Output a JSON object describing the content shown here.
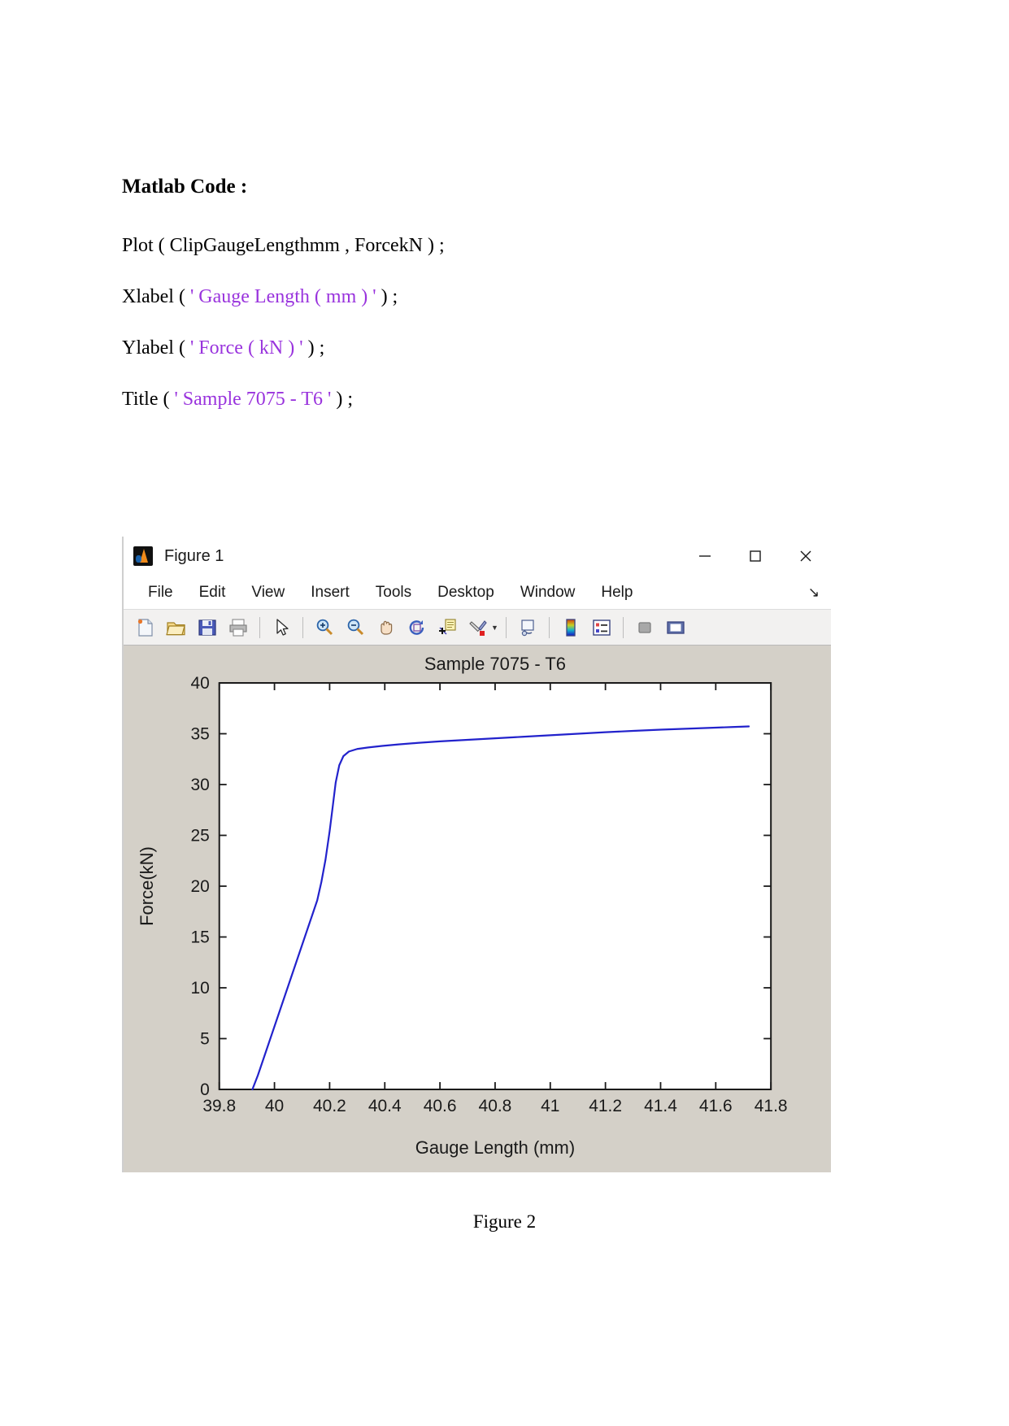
{
  "document": {
    "heading": "Matlab Code :",
    "code_lines": [
      {
        "pre": "Plot ( ClipGaugeLengthmm , ForcekN ) ;",
        "str": "",
        "post": ""
      },
      {
        "pre": "Xlabel ( ",
        "str": "' Gauge Length ( mm ) '",
        "post": " ) ;"
      },
      {
        "pre": "Ylabel ( ",
        "str": "' Force ( kN ) '",
        "post": " ) ;"
      },
      {
        "pre": "Title ( ",
        "str": "' Sample 7075 - T6 '",
        "post": " ) ;"
      }
    ],
    "caption": "Figure 2",
    "string_color": "#9933dd"
  },
  "figure_window": {
    "title": "Figure 1",
    "app_icon": "matlab-icon",
    "window_controls": [
      {
        "name": "minimize-button",
        "glyph": "minimize-icon"
      },
      {
        "name": "maximize-button",
        "glyph": "maximize-icon"
      },
      {
        "name": "close-button",
        "glyph": "close-icon"
      }
    ],
    "menu": [
      "File",
      "Edit",
      "View",
      "Insert",
      "Tools",
      "Desktop",
      "Window",
      "Help"
    ],
    "menu_overflow": "↘",
    "toolbar": [
      {
        "name": "new-figure-icon",
        "type": "icon"
      },
      {
        "name": "open-file-icon",
        "type": "icon"
      },
      {
        "name": "save-figure-icon",
        "type": "icon"
      },
      {
        "name": "print-figure-icon",
        "type": "icon"
      },
      {
        "name": "separator",
        "type": "sep"
      },
      {
        "name": "edit-plot-pointer-icon",
        "type": "icon"
      },
      {
        "name": "separator",
        "type": "sep"
      },
      {
        "name": "zoom-in-icon",
        "type": "icon"
      },
      {
        "name": "zoom-out-icon",
        "type": "icon"
      },
      {
        "name": "pan-hand-icon",
        "type": "icon"
      },
      {
        "name": "rotate-3d-icon",
        "type": "icon"
      },
      {
        "name": "data-cursor-icon",
        "type": "icon"
      },
      {
        "name": "brush-data-icon",
        "type": "icon"
      },
      {
        "name": "brush-dropdown-caret-icon",
        "type": "caret"
      },
      {
        "name": "separator",
        "type": "sep"
      },
      {
        "name": "link-plot-icon",
        "type": "icon"
      },
      {
        "name": "separator",
        "type": "sep"
      },
      {
        "name": "insert-colorbar-icon",
        "type": "icon"
      },
      {
        "name": "insert-legend-icon",
        "type": "icon"
      },
      {
        "name": "separator",
        "type": "sep"
      },
      {
        "name": "hide-plot-tools-icon",
        "type": "icon"
      },
      {
        "name": "show-plot-tools-icon",
        "type": "icon"
      }
    ]
  },
  "chart_data": {
    "type": "line",
    "title": "Sample 7075 - T6",
    "xlabel": "Gauge Length (mm)",
    "ylabel": "Force(kN)",
    "xlim": [
      39.8,
      41.8
    ],
    "ylim": [
      0,
      40
    ],
    "xticks": [
      "39.8",
      "40",
      "40.2",
      "40.4",
      "40.6",
      "40.8",
      "41",
      "41.2",
      "41.4",
      "41.6",
      "41.8"
    ],
    "yticks": [
      "0",
      "5",
      "10",
      "15",
      "20",
      "25",
      "30",
      "35",
      "40"
    ],
    "grid": false,
    "legend": null,
    "series": [
      {
        "name": "ForcekN",
        "color": "#2222cc",
        "x": [
          39.92,
          39.94,
          39.96,
          39.98,
          40.0,
          40.02,
          40.04,
          40.06,
          40.08,
          40.1,
          40.12,
          40.14,
          40.155,
          40.17,
          40.185,
          40.2,
          40.212,
          40.222,
          40.235,
          40.25,
          40.27,
          40.3,
          40.34,
          40.39,
          40.45,
          40.52,
          40.6,
          40.7,
          40.8,
          40.9,
          41.0,
          41.1,
          41.2,
          41.3,
          41.4,
          41.5,
          41.6,
          41.66,
          41.72
        ],
        "y": [
          0.0,
          1.4,
          3.0,
          4.6,
          6.2,
          7.8,
          9.4,
          11.0,
          12.6,
          14.2,
          15.8,
          17.4,
          18.6,
          20.4,
          22.6,
          25.4,
          28.0,
          30.2,
          31.9,
          32.8,
          33.25,
          33.5,
          33.65,
          33.8,
          33.95,
          34.1,
          34.25,
          34.4,
          34.55,
          34.7,
          34.85,
          35.0,
          35.15,
          35.28,
          35.4,
          35.5,
          35.6,
          35.66,
          35.72
        ]
      }
    ]
  }
}
